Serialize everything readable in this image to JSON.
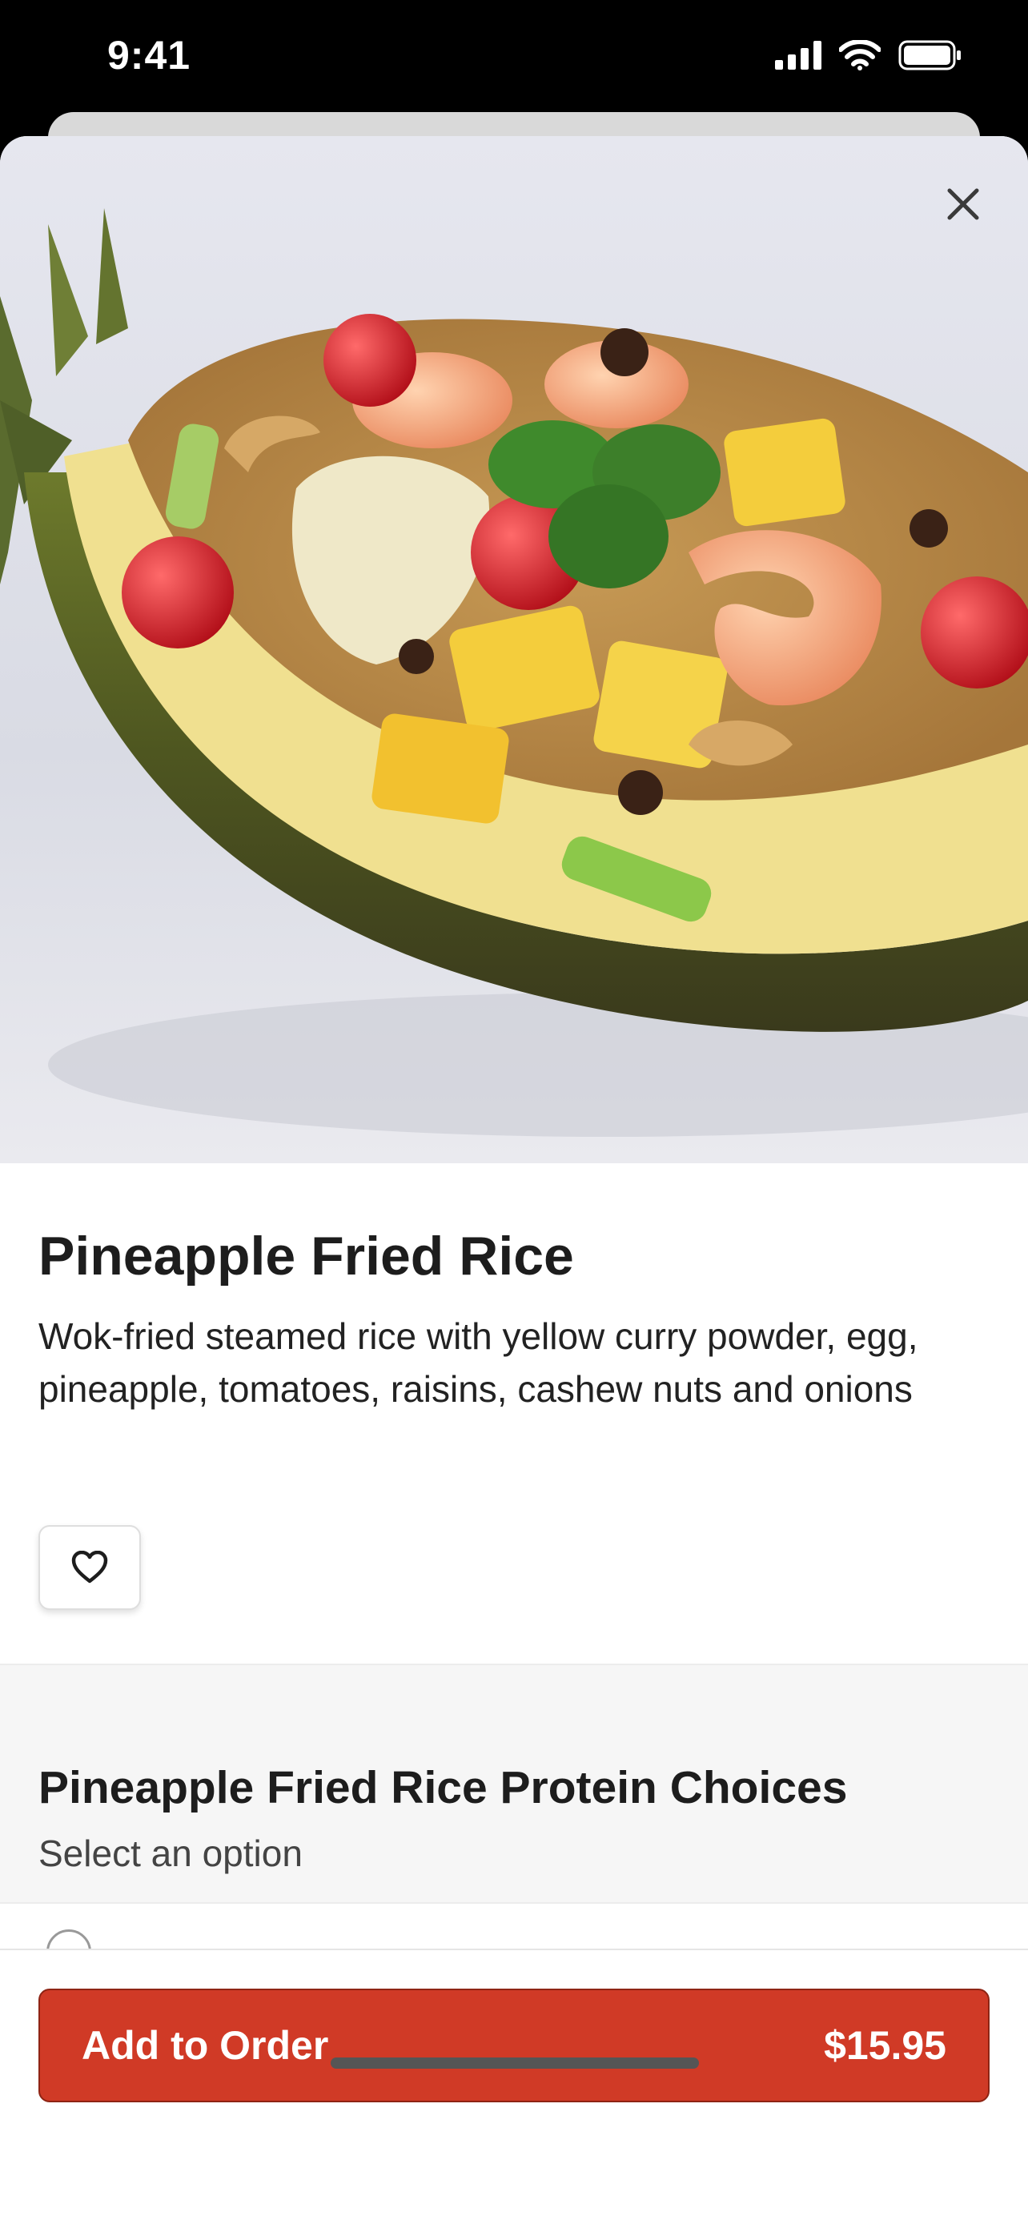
{
  "status_bar": {
    "time": "9:41",
    "icons": [
      "signal-icon",
      "wifi-icon",
      "battery-icon"
    ]
  },
  "item": {
    "name": "Pineapple Fried Rice",
    "description": "Wok-fried steamed rice with yellow curry powder, egg, pineapple, tomatoes, raisins, cashew nuts and onions"
  },
  "icons": {
    "close": "close-icon",
    "favorite": "heart-icon"
  },
  "options": {
    "title": "Pineapple Fried Rice Protein Choices",
    "subtitle": "Select an option"
  },
  "order": {
    "button_label": "Add to Order",
    "price": "$15.95"
  },
  "colors": {
    "accent": "#d03a26",
    "accent_border": "#8e2414",
    "section_bg": "#f6f6f6",
    "text_primary": "#1d1d1d"
  }
}
